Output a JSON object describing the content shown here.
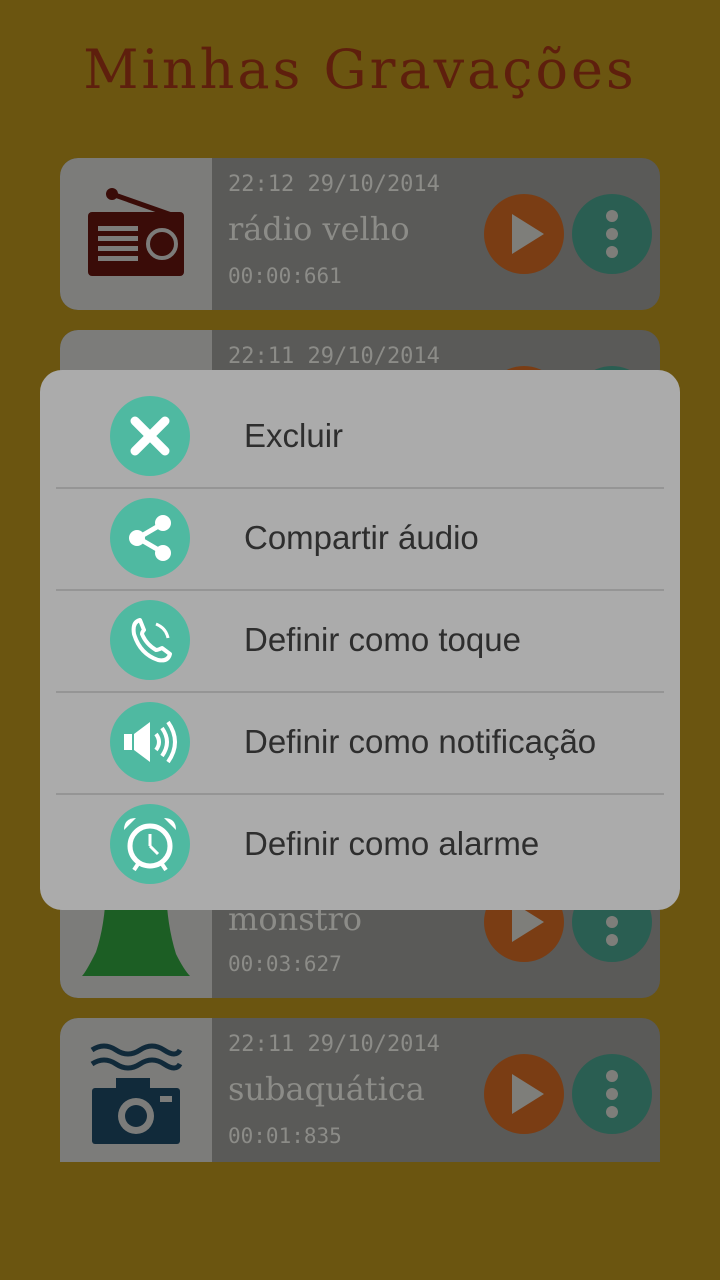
{
  "app": {
    "title": "Minhas Gravações"
  },
  "recordings": [
    {
      "date": "22:12 29/10/2014",
      "name": "rádio velho",
      "duration": "00:00:661",
      "thumb_icon": "radio-icon"
    },
    {
      "date": "22:11 29/10/2014",
      "name": "",
      "duration": "",
      "thumb_icon": "partial-icon"
    },
    {
      "date": "",
      "name": "monstro",
      "duration": "00:03:627",
      "thumb_icon": "monster-icon"
    },
    {
      "date": "22:11 29/10/2014",
      "name": "subaquática",
      "duration": "00:01:835",
      "thumb_icon": "underwater-camera-icon"
    }
  ],
  "dialog": {
    "items": [
      {
        "label": "Excluir",
        "icon": "close-icon"
      },
      {
        "label": "Compartir áudio",
        "icon": "share-icon"
      },
      {
        "label": "Definir como toque",
        "icon": "phone-icon"
      },
      {
        "label": "Definir como notificação",
        "icon": "speaker-icon"
      },
      {
        "label": "Definir como alarme",
        "icon": "alarm-clock-icon"
      }
    ]
  },
  "colors": {
    "background": "#6b5510",
    "title": "#5e1f0d",
    "card": "#5a5a58",
    "play_button": "#7a3d14",
    "more_button": "#2a5e52",
    "dialog": "#ababab",
    "menu_icon": "#4fb9a1"
  }
}
